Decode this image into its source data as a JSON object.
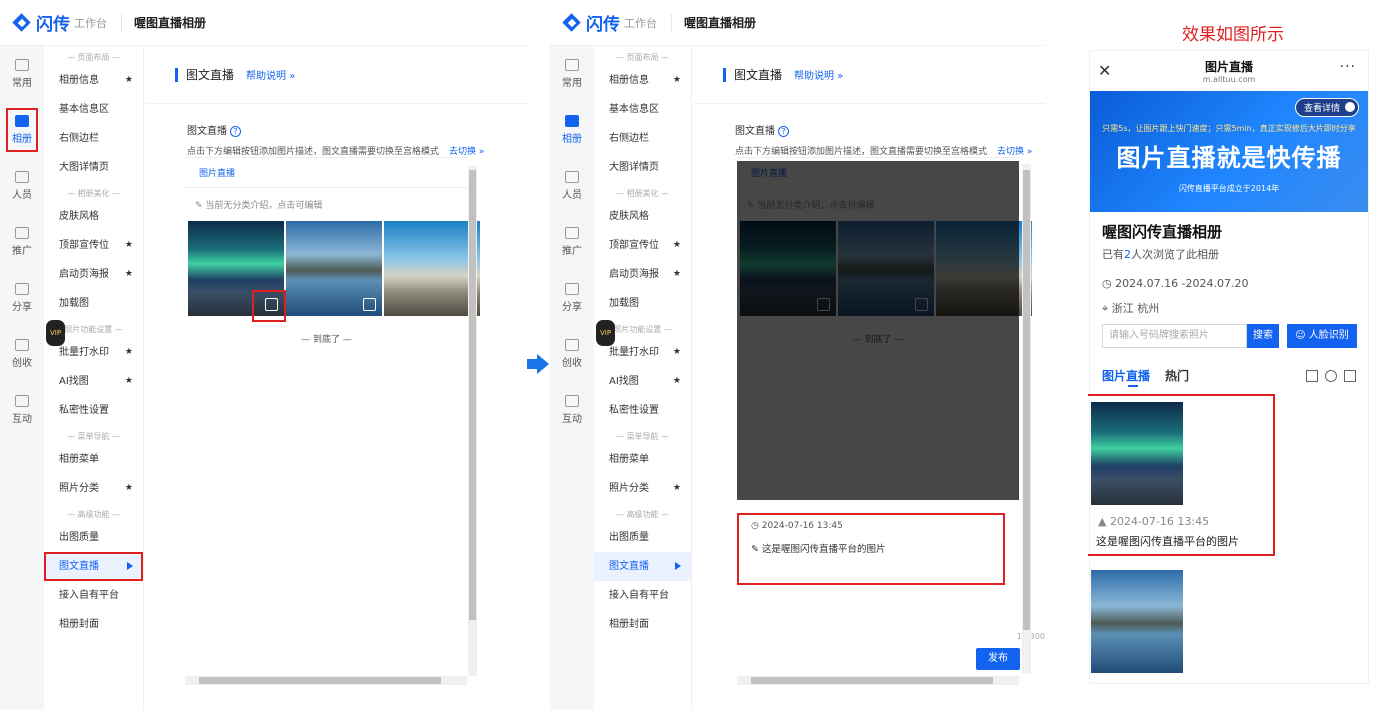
{
  "app": {
    "brand": "闪传",
    "workspace": "工作台",
    "page_title": "喔图直播相册"
  },
  "nav_primary": [
    {
      "label": "常用",
      "icon": "star-icon"
    },
    {
      "label": "相册",
      "icon": "album-icon"
    },
    {
      "label": "人员",
      "icon": "people-icon"
    },
    {
      "label": "推广",
      "icon": "promote-icon"
    },
    {
      "label": "分享",
      "icon": "share-icon"
    },
    {
      "label": "创收",
      "icon": "revenue-icon"
    },
    {
      "label": "互动",
      "icon": "interact-icon"
    }
  ],
  "nav_secondary": {
    "group_layout": "— 页面布局 —",
    "group_beauty": "— 相册美化 —",
    "group_photo": "照片功能设置 —",
    "group_menu": "— 菜单导航 —",
    "group_advanced": "— 高级功能 —",
    "vip": "VIP",
    "items": [
      {
        "label": "相册信息",
        "star": "★"
      },
      {
        "label": "基本信息区",
        "star": ""
      },
      {
        "label": "右侧边栏",
        "star": ""
      },
      {
        "label": "大图详情页",
        "star": ""
      },
      {
        "label": "皮肤风格",
        "star": ""
      },
      {
        "label": "顶部宣传位",
        "star": "★"
      },
      {
        "label": "启动页海报",
        "star": "★"
      },
      {
        "label": "加载图",
        "star": ""
      },
      {
        "label": "批量打水印",
        "star": "★"
      },
      {
        "label": "AI找图",
        "star": "★"
      },
      {
        "label": "私密性设置",
        "star": ""
      },
      {
        "label": "相册菜单",
        "star": ""
      },
      {
        "label": "照片分类",
        "star": "★"
      },
      {
        "label": "出图质量",
        "star": ""
      },
      {
        "label": "图文直播",
        "star": ""
      },
      {
        "label": "接入自有平台",
        "star": ""
      },
      {
        "label": "相册封面",
        "star": ""
      }
    ]
  },
  "section": {
    "title": "图文直播",
    "help": "帮助说明 »",
    "editor_title": "图文直播",
    "help_mark": "?",
    "description": "点击下方编辑按钮添加图片描述，图文直播需要切换至宫格模式",
    "switch_link": "去切换 »",
    "tab": "图片直播",
    "category_note": "当前无分类介绍，点击可编辑",
    "end_note": "—    到底了    —"
  },
  "caption_editor": {
    "time": "2024-07-16 13:45",
    "text": "这是喔图闪传直播平台的图片",
    "count": "13/300",
    "publish": "发布"
  },
  "effect": {
    "label": "效果如图所示",
    "page_title": "图片直播",
    "url": "m.alltuu.com",
    "banner_button": "查看详情",
    "banner_line1": "只需5s，让图片跟上快门速度；只需5min，真正实现修后大片即时分享",
    "banner_title": "图片直播就是快传播",
    "banner_line3": "闪传直播平台成立于2014年",
    "album_title": "喔图闪传直播相册",
    "views_prefix": "已有",
    "views_count": "2",
    "views_suffix": "人次浏览了此相册",
    "date_range": "2024.07.16 -2024.07.20",
    "location": "浙江 杭州",
    "search_placeholder": "请输入号码牌搜索照片",
    "search_button": "搜索",
    "face_button": "人脸识别",
    "tab_live": "图片直播",
    "tab_hot": "热门",
    "photo_time": "2024-07-16 13:45",
    "photo_caption": "这是喔图闪传直播平台的图片"
  }
}
